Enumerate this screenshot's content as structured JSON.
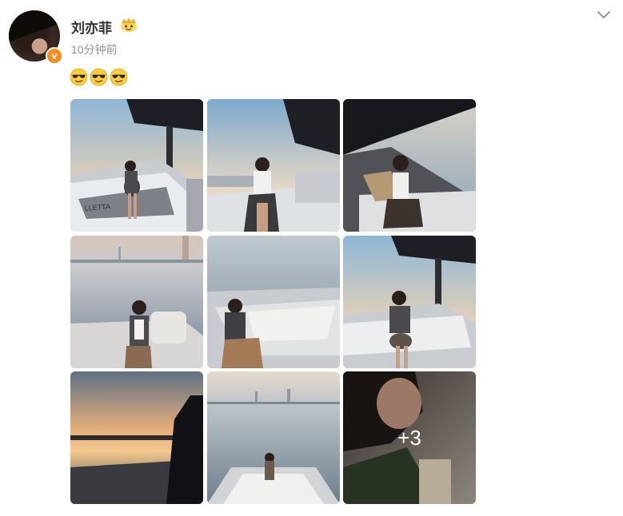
{
  "post": {
    "author": "刘亦菲",
    "verified_mark": "v",
    "time": "10分钟前",
    "content_emojis": [
      "sunglasses-emoji",
      "sunglasses-emoji",
      "sunglasses-emoji"
    ],
    "more_images_label": "+3"
  },
  "colors": {
    "username": "#333333",
    "time": "#939393",
    "verified_badge": "#f78b1f"
  },
  "icons": {
    "menu": "chevron-down-icon",
    "badge": "crown-icon"
  }
}
